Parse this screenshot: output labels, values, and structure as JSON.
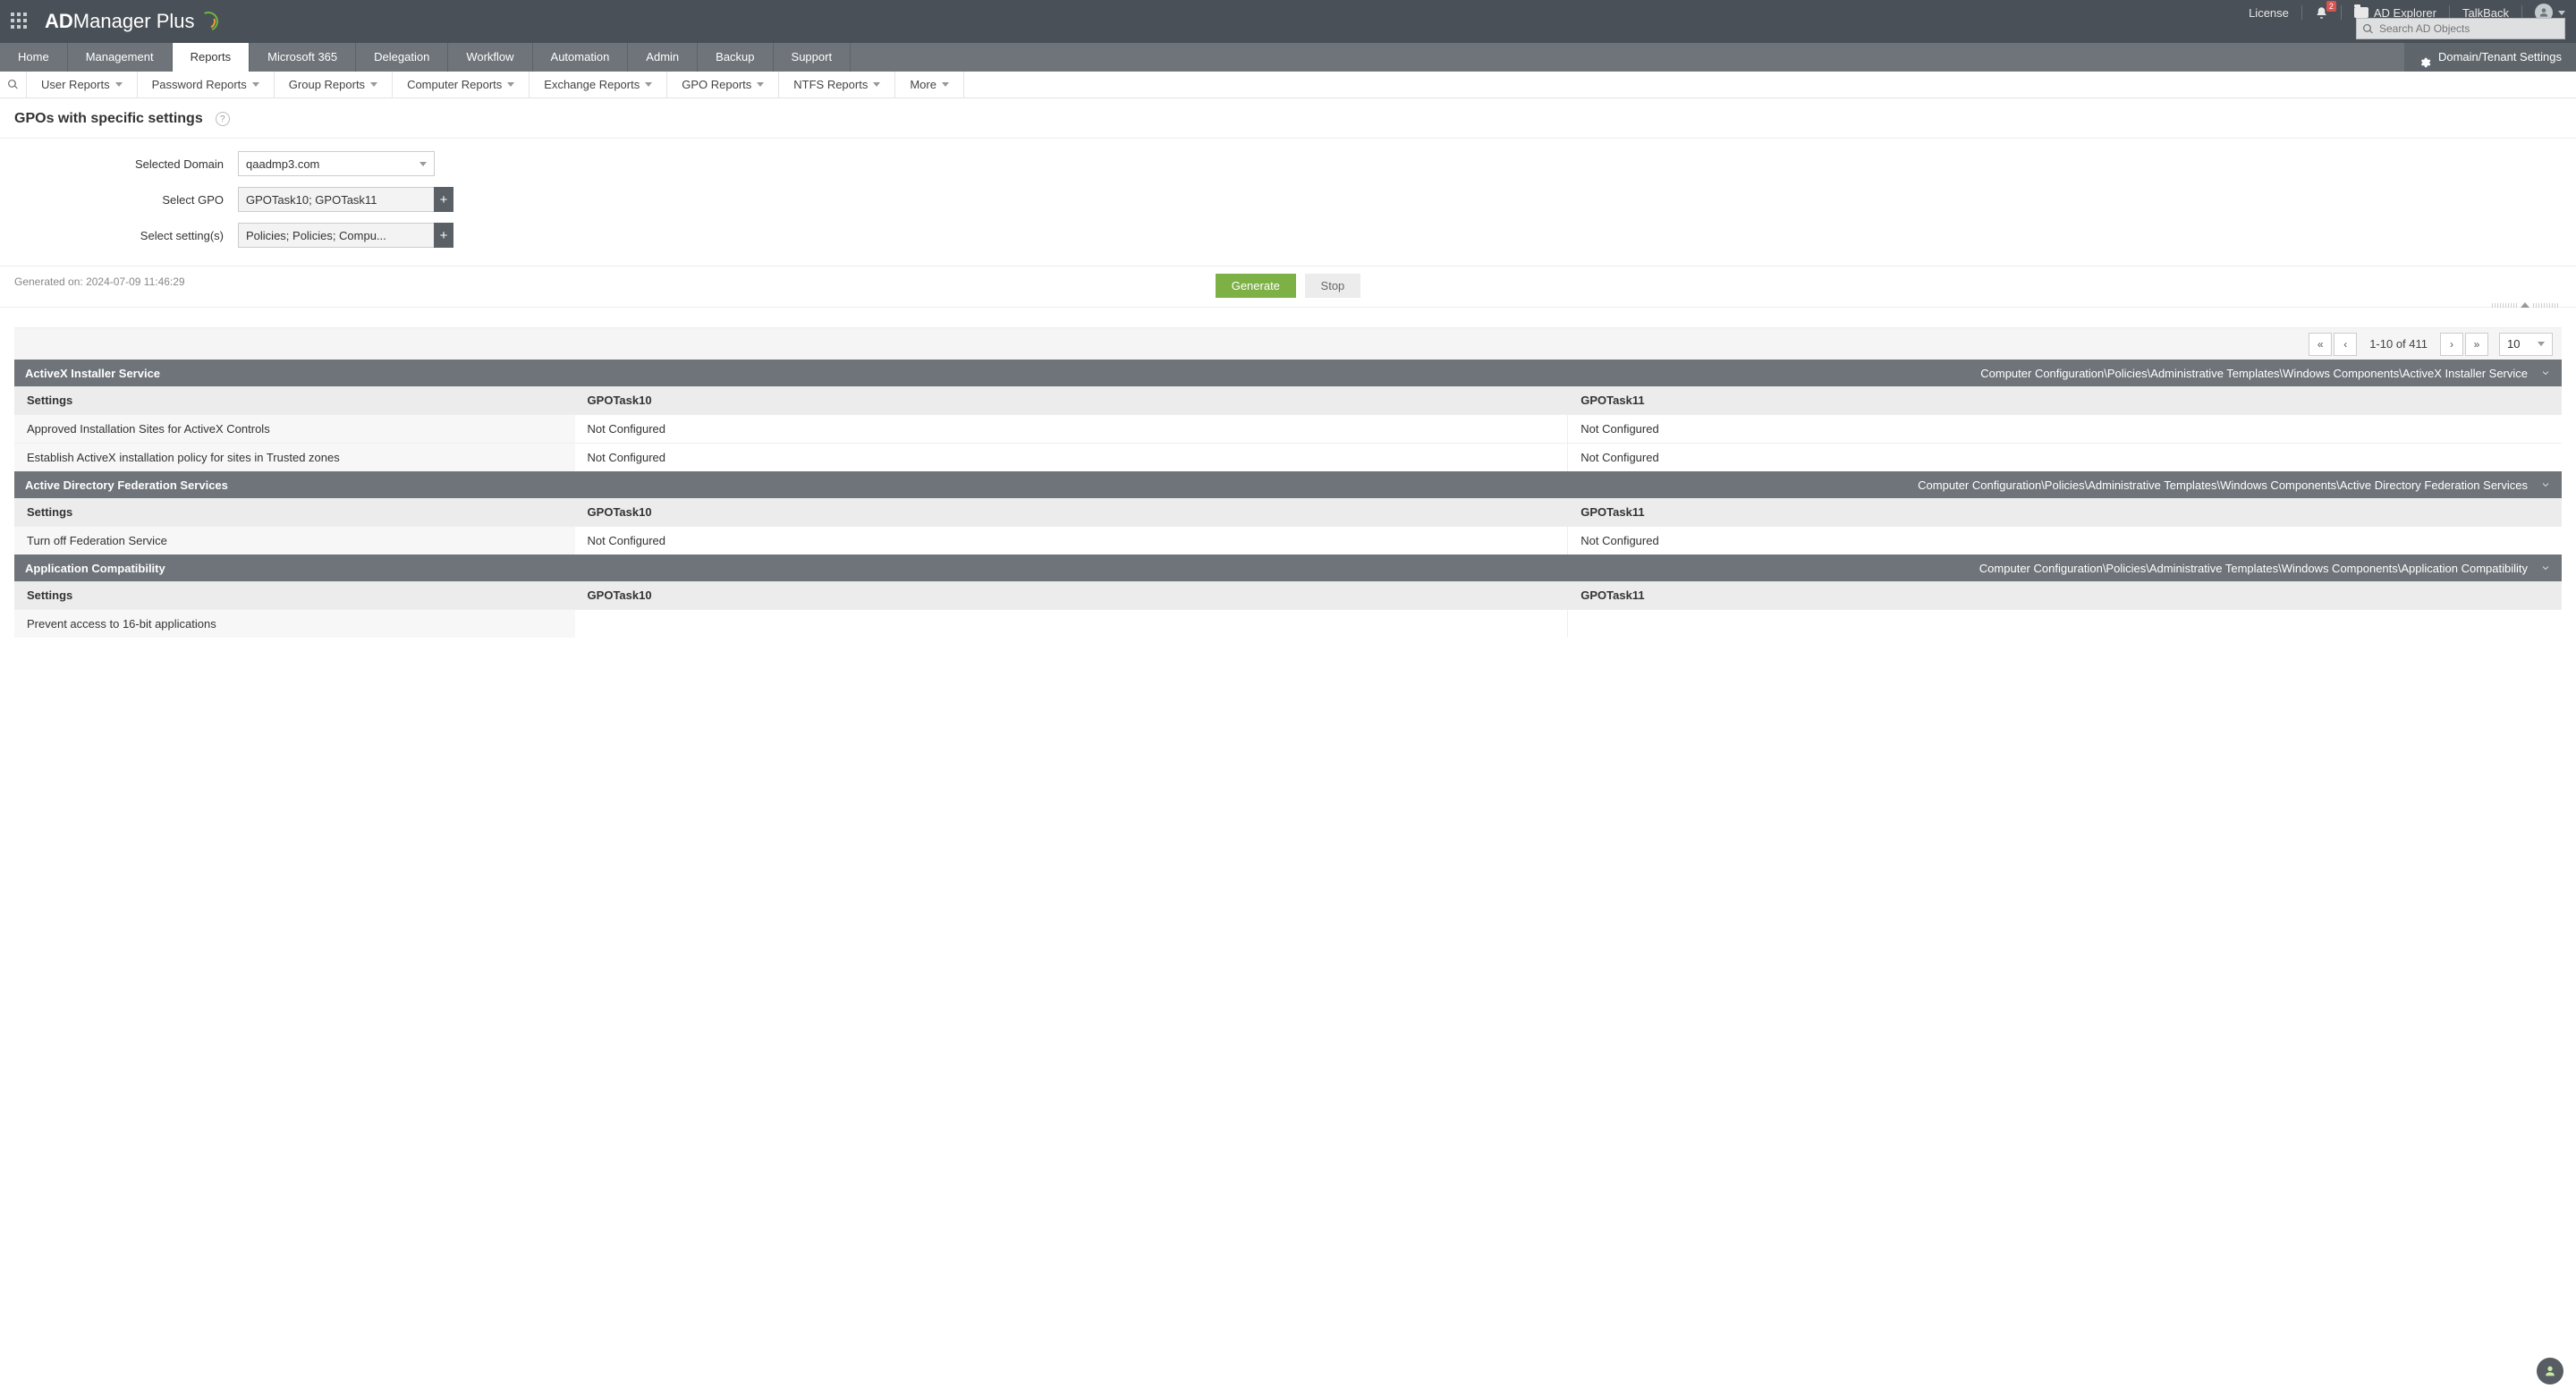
{
  "brand": {
    "a": "AD",
    "b": "Manager",
    "c": " Plus"
  },
  "top_links": {
    "license": "License",
    "explorer": "AD Explorer",
    "talkback": "TalkBack"
  },
  "notification_count": "2",
  "search_placeholder": "Search AD Objects",
  "main_nav": [
    "Home",
    "Management",
    "Reports",
    "Microsoft 365",
    "Delegation",
    "Workflow",
    "Automation",
    "Admin",
    "Backup",
    "Support"
  ],
  "main_nav_active": "Reports",
  "domain_settings_label": "Domain/Tenant Settings",
  "sub_nav": [
    "User Reports",
    "Password Reports",
    "Group Reports",
    "Computer Reports",
    "Exchange Reports",
    "GPO Reports",
    "NTFS Reports",
    "More"
  ],
  "page_title": "GPOs with specific settings",
  "form": {
    "selected_domain_label": "Selected Domain",
    "selected_domain_value": "qaadmp3.com",
    "select_gpo_label": "Select GPO",
    "select_gpo_value": "GPOTask10; GPOTask11",
    "select_settings_label": "Select setting(s)",
    "select_settings_value": "Policies; Policies; Compu..."
  },
  "generate_label": "Generate",
  "stop_label": "Stop",
  "generated_on_prefix": "Generated on: ",
  "generated_on": "2024-07-09 11:46:29",
  "pager": {
    "range": "1-10 of 411",
    "page_size": "10"
  },
  "columns": {
    "settings": "Settings",
    "a": "GPOTask10",
    "b": "GPOTask11"
  },
  "sections": [
    {
      "title": "ActiveX Installer Service",
      "path": "Computer Configuration\\Policies\\Administrative Templates\\Windows Components\\ActiveX Installer Service",
      "rows": [
        {
          "setting": "Approved Installation Sites for ActiveX Controls",
          "a": "Not Configured",
          "b": "Not Configured"
        },
        {
          "setting": "Establish ActiveX installation policy for sites in Trusted zones",
          "a": "Not Configured",
          "b": "Not Configured"
        }
      ]
    },
    {
      "title": "Active Directory Federation Services",
      "path": "Computer Configuration\\Policies\\Administrative Templates\\Windows Components\\Active Directory Federation Services",
      "rows": [
        {
          "setting": "Turn off Federation Service",
          "a": "Not Configured",
          "b": "Not Configured"
        }
      ]
    },
    {
      "title": "Application Compatibility",
      "path": "Computer Configuration\\Policies\\Administrative Templates\\Windows Components\\Application Compatibility",
      "rows": [
        {
          "setting": "Prevent access to 16-bit applications",
          "a": "",
          "b": ""
        }
      ]
    }
  ]
}
